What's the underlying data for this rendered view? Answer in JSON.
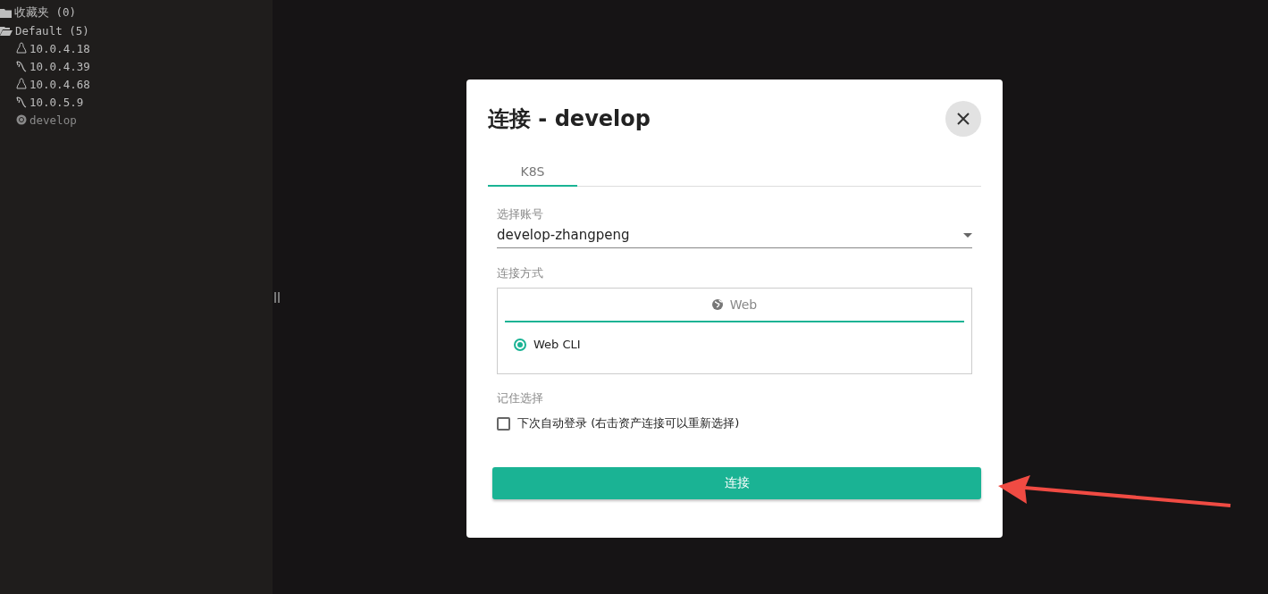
{
  "sidebar": {
    "tree": [
      {
        "kind": "folder",
        "label": "收藏夹 (0)",
        "expanded": false
      },
      {
        "kind": "folder",
        "label": "Default (5)",
        "expanded": true,
        "children": [
          {
            "kind": "linux",
            "label": "10.0.4.18"
          },
          {
            "kind": "feather",
            "label": "10.0.4.39"
          },
          {
            "kind": "linux",
            "label": "10.0.4.68"
          },
          {
            "kind": "feather",
            "label": "10.0.5.9"
          },
          {
            "kind": "k8s",
            "label": "develop"
          }
        ]
      }
    ]
  },
  "dialog": {
    "title": "连接 - develop",
    "tabs": [
      {
        "label": "K8S",
        "selected": true
      }
    ],
    "account": {
      "label": "选择账号",
      "value": "develop-zhangpeng"
    },
    "method": {
      "label": "连接方式",
      "tabs": [
        {
          "label": "Web",
          "selected": true
        }
      ],
      "options": [
        {
          "label": "Web CLI",
          "selected": true
        }
      ]
    },
    "remember": {
      "label": "记住选择",
      "option": {
        "label": "下次自动登录 (右击资产连接可以重新选择)",
        "checked": false
      }
    },
    "submit": "连接"
  }
}
